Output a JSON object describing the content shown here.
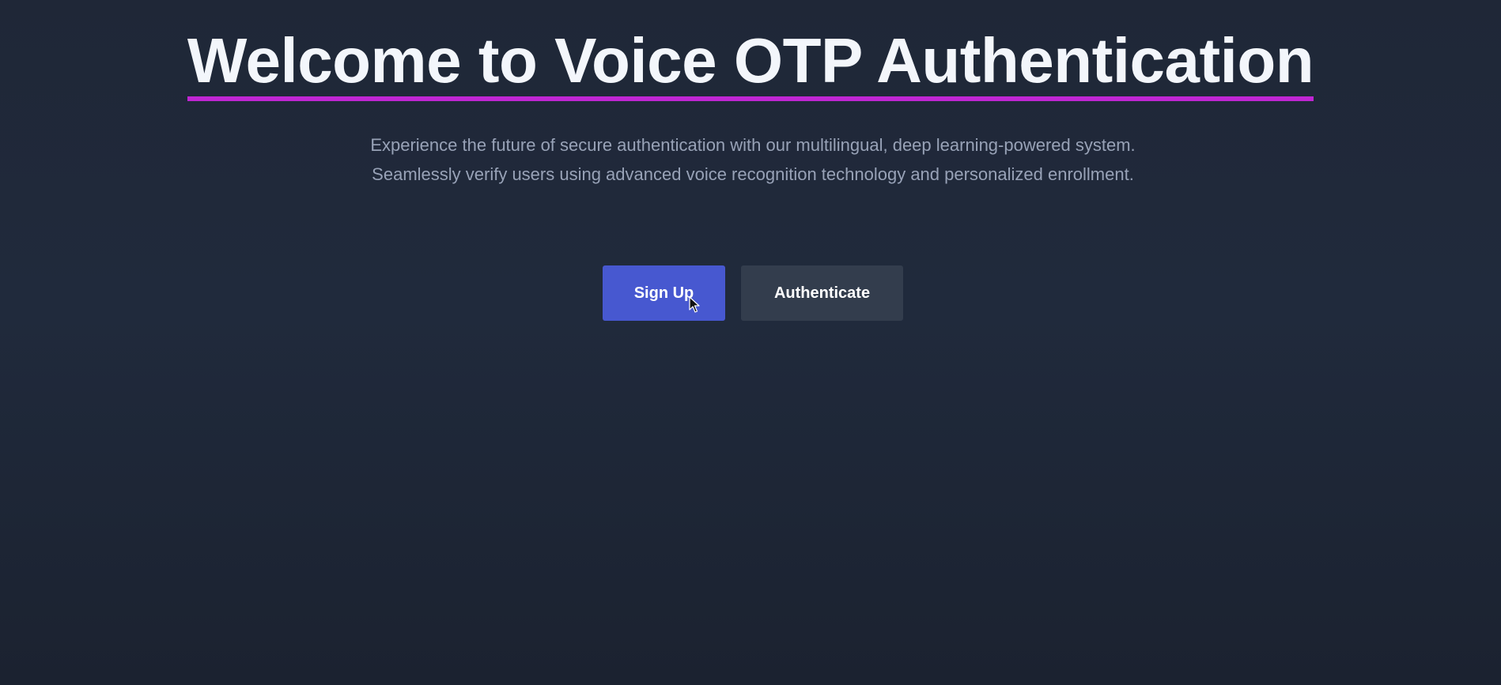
{
  "hero": {
    "title": "Welcome to Voice OTP Authentication",
    "subtitle": "Experience the future of secure authentication with our multilingual, deep learning-powered system. Seamlessly verify users using advanced voice recognition technology and personalized enrollment."
  },
  "actions": {
    "signup_label": "Sign Up",
    "authenticate_label": "Authenticate"
  },
  "colors": {
    "background": "#1f2737",
    "title_underline": "#c026d3",
    "primary_button": "#4758d0",
    "secondary_button": "#333d4d"
  },
  "icons": {
    "cursor": "mouse-pointer-icon"
  }
}
